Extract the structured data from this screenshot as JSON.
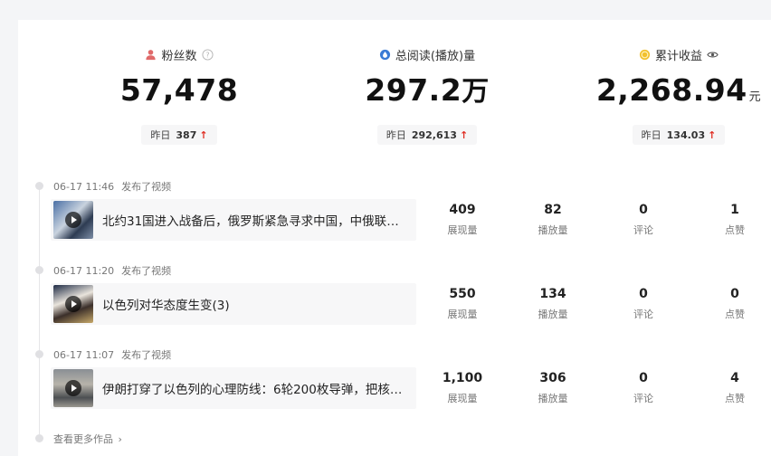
{
  "stats": {
    "fans": {
      "label": "粉丝数",
      "value": "57,478",
      "yesterday_label": "昨日",
      "yesterday_value": "387"
    },
    "reads": {
      "label": "总阅读(播放)量",
      "value": "297.2",
      "unit": "万",
      "yesterday_label": "昨日",
      "yesterday_value": "292,613"
    },
    "income": {
      "label": "累计收益",
      "value": "2,268.94",
      "unit": "元",
      "yesterday_label": "昨日",
      "yesterday_value": "134.03"
    }
  },
  "posts": [
    {
      "time": "06-17 11:46",
      "action": "发布了视频",
      "title": "北约31国进入战备后，俄罗斯紧急寻求中国，中俄联合…",
      "metrics": [
        {
          "value": "409",
          "label": "展现量"
        },
        {
          "value": "82",
          "label": "播放量"
        },
        {
          "value": "0",
          "label": "评论"
        },
        {
          "value": "1",
          "label": "点赞"
        }
      ]
    },
    {
      "time": "06-17 11:20",
      "action": "发布了视频",
      "title": "以色列对华态度生变(3)",
      "metrics": [
        {
          "value": "550",
          "label": "展现量"
        },
        {
          "value": "134",
          "label": "播放量"
        },
        {
          "value": "0",
          "label": "评论"
        },
        {
          "value": "0",
          "label": "点赞"
        }
      ]
    },
    {
      "time": "06-17 11:07",
      "action": "发布了视频",
      "title": "伊朗打穿了以色列的心理防线：6轮200枚导弹，把核设…",
      "metrics": [
        {
          "value": "1,100",
          "label": "展现量"
        },
        {
          "value": "306",
          "label": "播放量"
        },
        {
          "value": "0",
          "label": "评论"
        },
        {
          "value": "4",
          "label": "点赞"
        }
      ]
    }
  ],
  "more_link": "查看更多作品",
  "colors": {
    "up_arrow": "#e02e24",
    "fans_icon": "#e06a6a",
    "reads_icon": "#3a7bd5",
    "income_icon": "#f2c12e"
  },
  "icons": {
    "fans": "person-icon",
    "fans_help": "question-icon",
    "reads": "droplet-icon",
    "income": "coin-icon",
    "income_visibility": "eye-icon",
    "up": "arrow-up-icon",
    "play": "play-icon",
    "more": "chevron-right-icon"
  }
}
